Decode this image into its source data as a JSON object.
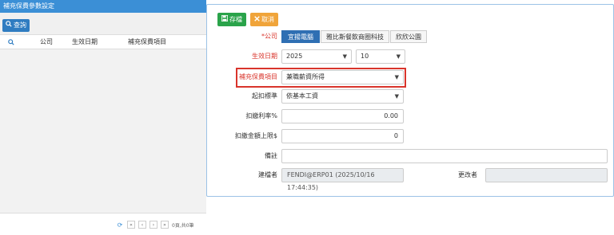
{
  "left": {
    "title": "補充保費參數設定",
    "query_label": "查詢",
    "columns": [
      "公司",
      "生效日期",
      "補充保費項目"
    ],
    "pager": {
      "first": "«",
      "prev": "‹",
      "next": "›",
      "last": "»",
      "info": "0頁,共0筆"
    }
  },
  "toolbar": {
    "save_label": "存檔",
    "cancel_label": "取消"
  },
  "form": {
    "company_label": "*公司",
    "company_tabs": [
      "宜揚電腦",
      "雅比斯餐飲商圈科技",
      "欣欣公園"
    ],
    "effective_label": "生效日期",
    "year": "2025",
    "month": "10",
    "item_label": "補充保費項目",
    "item_value": "兼職薪資所得",
    "threshold_label": "起扣標準",
    "threshold_value": "依基本工資",
    "rate_label": "扣繳利率%",
    "rate_value": "0.00",
    "cap_label": "扣繳金額上限$",
    "cap_value": "0",
    "note_label": "備註",
    "note_value": "",
    "creator_label": "建檔者",
    "creator_value": "FENDI@ERP01 (2025/10/16 17:44:35)",
    "modifier_label": "更改者",
    "modifier_value": ""
  },
  "colors": {
    "header_blue": "#3b8fd6",
    "save_green": "#2aa34a",
    "cancel_orange": "#f0a43a",
    "tab_active": "#2f6fb3",
    "required_red": "#d9342b"
  }
}
